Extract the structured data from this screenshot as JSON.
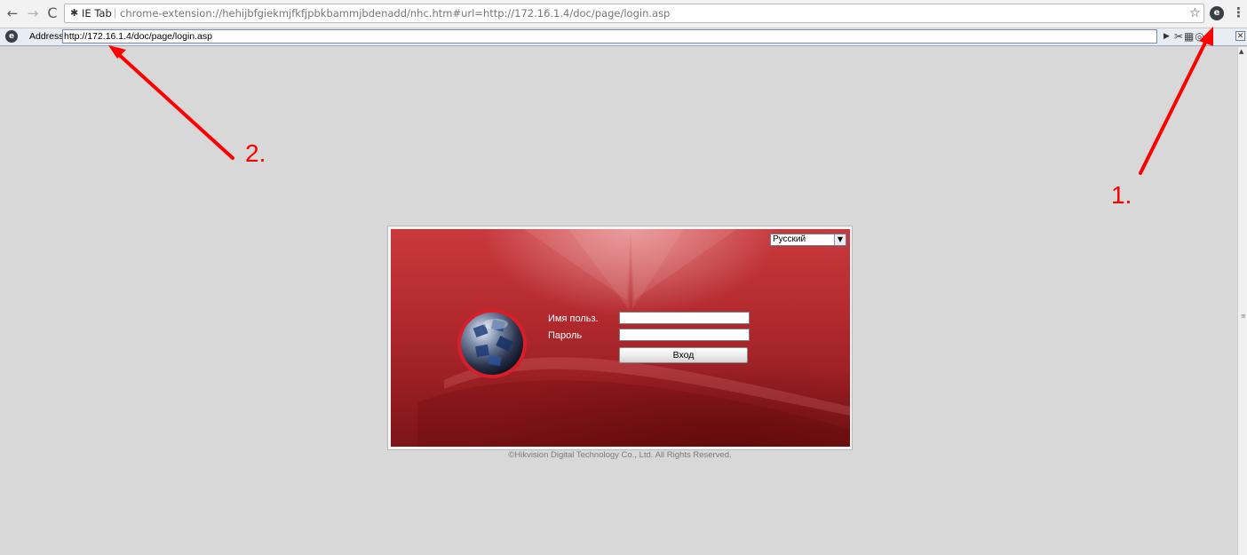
{
  "browser": {
    "omnibox": {
      "chip_label": "IE Tab",
      "url": "chrome-extension://hehijbfgiekmjfkfjpbkbammjbdenadd/nhc.htm#url=http://172.16.1.4/doc/page/login.asp"
    },
    "icons": {
      "back": "←",
      "forward": "→",
      "reload": "C",
      "chip": "✱",
      "star": "☆",
      "ietab": "e",
      "menu": "⋮"
    }
  },
  "ie_tab": {
    "logo": "e",
    "address_label": "Address:",
    "address_value": "http://172.16.1.4/doc/page/login.asp",
    "go_icon": "▶",
    "tools_icon": "✂▦◎",
    "close_icon": "✕"
  },
  "login": {
    "language": "Русский",
    "language_arrow": "▼",
    "username_label": "Имя польз.",
    "password_label": "Пароль",
    "username_value": "",
    "password_value": "",
    "login_button": "Вход",
    "copyright": "©Hikvision Digital Technology Co., Ltd. All Rights Reserved."
  },
  "annotations": {
    "label_1": "1.",
    "label_2": "2.",
    "color": "#ff0000"
  },
  "colors": {
    "panel_red": "#b32a2e",
    "page_bg": "#d8d8d8"
  }
}
